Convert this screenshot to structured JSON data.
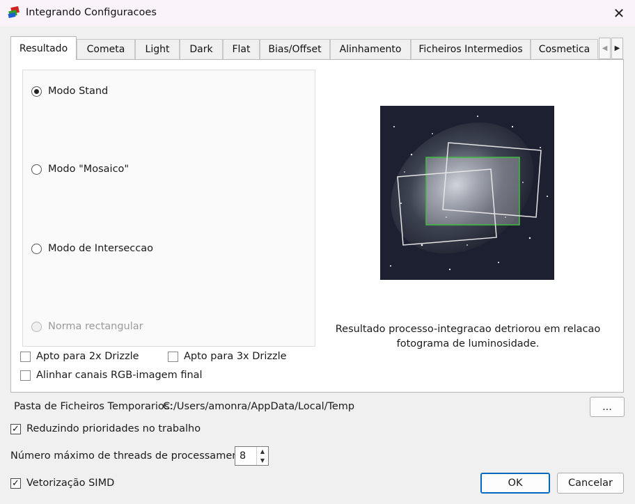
{
  "window": {
    "title": "Integrando Configuracoes",
    "close_glyph": "✕"
  },
  "tabs": [
    {
      "label": "Resultado",
      "active": true
    },
    {
      "label": "Cometa"
    },
    {
      "label": "Light"
    },
    {
      "label": "Dark"
    },
    {
      "label": "Flat"
    },
    {
      "label": "Bias/Offset"
    },
    {
      "label": "Alinhamento"
    },
    {
      "label": "Ficheiros Intermedios"
    },
    {
      "label": "Cosmetica"
    }
  ],
  "tab_scroll": {
    "left_glyph": "◀",
    "right_glyph": "▶"
  },
  "modes": [
    {
      "label": "Modo Stand",
      "checked": true
    },
    {
      "label": "Modo \"Mosaico\"",
      "checked": false
    },
    {
      "label": "Modo de Interseccao",
      "checked": false
    },
    {
      "label": "Norma rectangular",
      "checked": false,
      "disabled": true
    }
  ],
  "options": {
    "drizzle2x": {
      "label": "Apto para 2x Drizzle",
      "checked": false
    },
    "drizzle3x": {
      "label": "Apto para 3x Drizzle",
      "checked": false
    },
    "align_rgb": {
      "label": "Alinhar canais RGB-imagem final",
      "checked": false
    }
  },
  "preview_caption": "Resultado processo-integracao detriorou em relacao fotograma de luminosidade.",
  "temp_folder": {
    "label": "Pasta de Ficheiros Temporarios:",
    "path": "C:/Users/amonra/AppData/Local/Temp",
    "browse_label": "..."
  },
  "reduce_priority": {
    "label": "Reduzindo prioridades no trabalho",
    "checked": true
  },
  "threads": {
    "label": "Número máximo de threads de processamento",
    "value": "8"
  },
  "simd": {
    "label": "Vetorização SIMD",
    "checked": true
  },
  "buttons": {
    "ok": "OK",
    "cancel": "Cancelar"
  },
  "colors": {
    "accent": "#0067c0",
    "selection_green": "#3fbf3f",
    "frame_white": "#e6e6e6"
  }
}
